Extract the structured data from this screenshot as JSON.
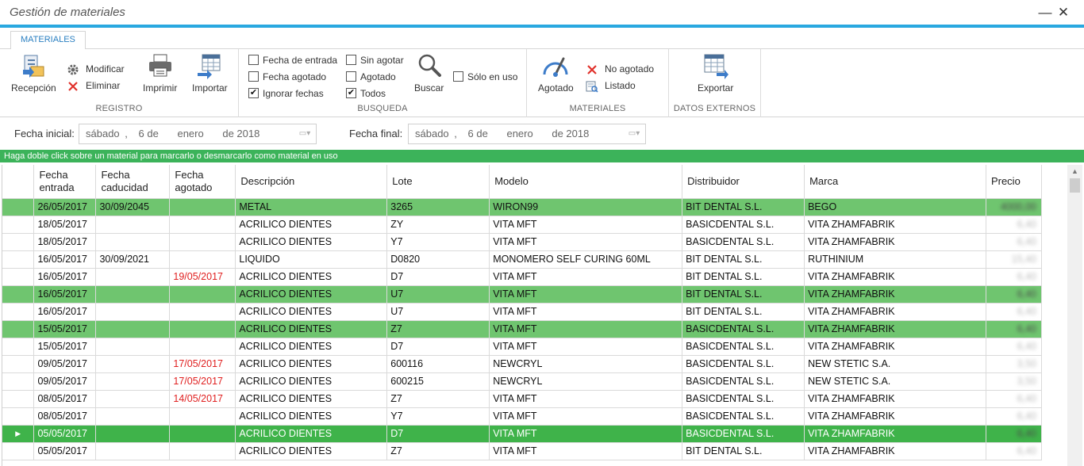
{
  "window": {
    "title": "Gestión de materiales",
    "min_glyph": "—",
    "close_glyph": "✕"
  },
  "tabs": [
    {
      "label": "MATERIALES"
    }
  ],
  "ribbon": {
    "registro": {
      "label": "REGISTRO",
      "recepcion": "Recepción",
      "modificar": "Modificar",
      "eliminar": "Eliminar",
      "imprimir": "Imprimir",
      "importar": "Importar"
    },
    "busqueda": {
      "label": "BUSQUEDA",
      "fecha_entrada": "Fecha de entrada",
      "fecha_agotado": "Fecha agotado",
      "ignorar_fechas": "Ignorar fechas",
      "sin_agotar": "Sin agotar",
      "agotado": "Agotado",
      "todos": "Todos",
      "buscar": "Buscar",
      "solo_en_uso": "Sólo en uso",
      "check_mark": "✔",
      "checked": {
        "fecha_entrada": false,
        "fecha_agotado": false,
        "ignorar_fechas": true,
        "sin_agotar": false,
        "agotado": false,
        "todos": true,
        "solo_en_uso": false
      }
    },
    "materiales": {
      "label": "MATERIALES",
      "agotado": "Agotado",
      "no_agotado": "No agotado",
      "listado": "Listado"
    },
    "datos_externos": {
      "label": "DATOS EXTERNOS",
      "exportar": "Exportar"
    }
  },
  "filters": {
    "fecha_inicial": {
      "label": "Fecha inicial:",
      "weekday": "sábado",
      "sep": ",",
      "day": "6 de",
      "month": "enero",
      "year": "de 2018"
    },
    "fecha_final": {
      "label": "Fecha final:",
      "weekday": "sábado",
      "sep": ",",
      "day": "6 de",
      "month": "enero",
      "year": "de 2018"
    }
  },
  "info_text": "Haga doble click sobre un material para marcarlo o desmarcarlo como material en uso",
  "table": {
    "columns": [
      {
        "l1": "Fecha",
        "l2": "entrada"
      },
      {
        "l1": "Fecha",
        "l2": "caducidad"
      },
      {
        "l1": "Fecha",
        "l2": "agotado"
      },
      {
        "l1": "Descripción",
        "l2": ""
      },
      {
        "l1": "Lote",
        "l2": ""
      },
      {
        "l1": "Modelo",
        "l2": ""
      },
      {
        "l1": "Distribuidor",
        "l2": ""
      },
      {
        "l1": "Marca",
        "l2": ""
      },
      {
        "l1": "Precio",
        "l2": ""
      }
    ],
    "current_row_marker": "▶",
    "rows": [
      {
        "in_use": true,
        "current": false,
        "entrada": "26/05/2017",
        "caducidad": "30/09/2045",
        "agotado": "",
        "descripcion": "METAL",
        "lote": "3265",
        "modelo": "WIRON99",
        "distribuidor": "BIT DENTAL S.L.",
        "marca": "BEGO",
        "precio": "4000,00"
      },
      {
        "in_use": false,
        "current": false,
        "entrada": "18/05/2017",
        "caducidad": "",
        "agotado": "",
        "descripcion": "ACRILICO DIENTES",
        "lote": "ZY",
        "modelo": "VITA MFT",
        "distribuidor": "BASICDENTAL S.L.",
        "marca": "VITA ZHAMFABRIK",
        "precio": "6,40"
      },
      {
        "in_use": false,
        "current": false,
        "entrada": "18/05/2017",
        "caducidad": "",
        "agotado": "",
        "descripcion": "ACRILICO DIENTES",
        "lote": "Y7",
        "modelo": "VITA MFT",
        "distribuidor": "BASICDENTAL S.L.",
        "marca": "VITA ZHAMFABRIK",
        "precio": "6,40"
      },
      {
        "in_use": false,
        "current": false,
        "entrada": "16/05/2017",
        "caducidad": "30/09/2021",
        "agotado": "",
        "descripcion": "LIQUIDO",
        "lote": "D0820",
        "modelo": "MONOMERO SELF CURING 60ML",
        "distribuidor": "BIT DENTAL S.L.",
        "marca": "RUTHINIUM",
        "precio": "15,40"
      },
      {
        "in_use": false,
        "current": false,
        "entrada": "16/05/2017",
        "caducidad": "",
        "agotado": "19/05/2017",
        "descripcion": "ACRILICO DIENTES",
        "lote": "D7",
        "modelo": "VITA MFT",
        "distribuidor": "BIT DENTAL S.L.",
        "marca": "VITA ZHAMFABRIK",
        "precio": "6,40"
      },
      {
        "in_use": true,
        "current": false,
        "entrada": "16/05/2017",
        "caducidad": "",
        "agotado": "",
        "descripcion": "ACRILICO DIENTES",
        "lote": "U7",
        "modelo": "VITA MFT",
        "distribuidor": "BIT DENTAL S.L.",
        "marca": "VITA ZHAMFABRIK",
        "precio": "6,40"
      },
      {
        "in_use": false,
        "current": false,
        "entrada": "16/05/2017",
        "caducidad": "",
        "agotado": "",
        "descripcion": "ACRILICO DIENTES",
        "lote": "U7",
        "modelo": "VITA MFT",
        "distribuidor": "BIT DENTAL S.L.",
        "marca": "VITA ZHAMFABRIK",
        "precio": "6,40"
      },
      {
        "in_use": true,
        "current": false,
        "entrada": "15/05/2017",
        "caducidad": "",
        "agotado": "",
        "descripcion": "ACRILICO DIENTES",
        "lote": "Z7",
        "modelo": "VITA MFT",
        "distribuidor": "BASICDENTAL S.L.",
        "marca": "VITA ZHAMFABRIK",
        "precio": "6,40"
      },
      {
        "in_use": false,
        "current": false,
        "entrada": "15/05/2017",
        "caducidad": "",
        "agotado": "",
        "descripcion": "ACRILICO DIENTES",
        "lote": "D7",
        "modelo": "VITA MFT",
        "distribuidor": "BASICDENTAL S.L.",
        "marca": "VITA ZHAMFABRIK",
        "precio": "6,40"
      },
      {
        "in_use": false,
        "current": false,
        "entrada": "09/05/2017",
        "caducidad": "",
        "agotado": "17/05/2017",
        "descripcion": "ACRILICO DIENTES",
        "lote": "600116",
        "modelo": "NEWCRYL",
        "distribuidor": "BASICDENTAL S.L.",
        "marca": "NEW STETIC S.A.",
        "precio": "3,50"
      },
      {
        "in_use": false,
        "current": false,
        "entrada": "09/05/2017",
        "caducidad": "",
        "agotado": "17/05/2017",
        "descripcion": "ACRILICO DIENTES",
        "lote": "600215",
        "modelo": "NEWCRYL",
        "distribuidor": "BASICDENTAL S.L.",
        "marca": "NEW STETIC S.A.",
        "precio": "3,50"
      },
      {
        "in_use": false,
        "current": false,
        "entrada": "08/05/2017",
        "caducidad": "",
        "agotado": "14/05/2017",
        "descripcion": "ACRILICO DIENTES",
        "lote": "Z7",
        "modelo": "VITA MFT",
        "distribuidor": "BASICDENTAL S.L.",
        "marca": "VITA ZHAMFABRIK",
        "precio": "6,40"
      },
      {
        "in_use": false,
        "current": false,
        "entrada": "08/05/2017",
        "caducidad": "",
        "agotado": "",
        "descripcion": "ACRILICO DIENTES",
        "lote": "Y7",
        "modelo": "VITA MFT",
        "distribuidor": "BASICDENTAL S.L.",
        "marca": "VITA ZHAMFABRIK",
        "precio": "6,40"
      },
      {
        "in_use": true,
        "current": true,
        "entrada": "05/05/2017",
        "caducidad": "",
        "agotado": "",
        "descripcion": "ACRILICO DIENTES",
        "lote": "D7",
        "modelo": "VITA MFT",
        "distribuidor": "BASICDENTAL S.L.",
        "marca": "VITA ZHAMFABRIK",
        "precio": "6,40"
      },
      {
        "in_use": false,
        "current": false,
        "entrada": "05/05/2017",
        "caducidad": "",
        "agotado": "",
        "descripcion": "ACRILICO DIENTES",
        "lote": "Z7",
        "modelo": "VITA MFT",
        "distribuidor": "BIT DENTAL S.L.",
        "marca": "VITA ZHAMFABRIK",
        "precio": "6,40"
      }
    ]
  },
  "colors": {
    "accent": "#29a8e0",
    "in_use_row": "#6fc56f",
    "active_row": "#3fb34a",
    "info_bar": "#3cb35a",
    "agotado_text": "#e02020"
  }
}
